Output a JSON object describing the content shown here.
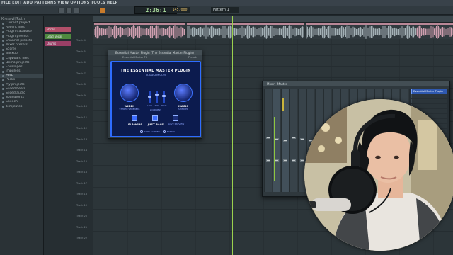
{
  "menu_text": "FILE EDIT ADD PATTERNS VIEW OPTIONS TOOLS HELP",
  "time_display": "2:36:1",
  "tempo": "145.000",
  "pattern_name": "Pattern 1",
  "left_hint": "Kresavil/Ruth",
  "browser": {
    "items": [
      "Current project",
      "Recent files",
      "Plugin database",
      "Plugin presets",
      "Channel presets",
      "Mixer presets",
      "Scores",
      "Backup",
      "Clipboard files",
      "Demo projects",
      "Envelopes",
      "Impulses",
      "Misc",
      "Packs",
      "My projects",
      "Sliced beats",
      "Sliced audio",
      "Soundfonts",
      "Speech",
      "Templates"
    ],
    "selected_index": 12
  },
  "tracks": {
    "headers": [
      {
        "label": "Vocal",
        "color": "#b2506a"
      },
      {
        "label": "Lead Vocal",
        "color": "#4f8a3f"
      },
      {
        "label": "Drums",
        "color": "#9a3f66"
      }
    ],
    "labels": [
      "Track 4",
      "Track 5",
      "Track 6",
      "Track 7",
      "Track 8",
      "Track 9",
      "Track 10",
      "Track 11",
      "Track 12",
      "Track 13",
      "Track 14",
      "Track 15",
      "Track 16",
      "Track 17",
      "Track 18",
      "Track 19",
      "Track 20",
      "Track 21",
      "Track 22"
    ]
  },
  "plugin": {
    "window_title": "Essential Master Plugin (The Essential Master Plugin)",
    "toolbar_left": "Essential Master FX",
    "toolbar_right": "Presets",
    "title": "THE ESSENTIAL MASTER PLUGIN",
    "website": "LOUDSAM.COM",
    "knob_left_label": "WIDEN",
    "knob_left_sub": "STEREO WIDENESS",
    "knob_right_label": "MAGIC",
    "knob_right_sub": "SHIMMER",
    "sliders": [
      "LOW",
      "MID",
      "HIGH"
    ],
    "slider_sub": "LOUDNESS",
    "button_flangus": "FLANGUS",
    "button_bass": "JUST BASS",
    "button_limiter": "LOVE PREVIEW",
    "radio_clipping": "SOFT CLIPPING",
    "radio_bypass": "BYPASS",
    "slider_levels": [
      0.55,
      0.7,
      0.6
    ]
  },
  "mixer": {
    "title": "Mixer - Master",
    "insert_selected": "Essential Master Plugin",
    "slot_count": 12
  },
  "colors": {
    "playhead": "#9bd14e",
    "plugin_accent": "#2e6cff",
    "clip": "#b98797"
  }
}
